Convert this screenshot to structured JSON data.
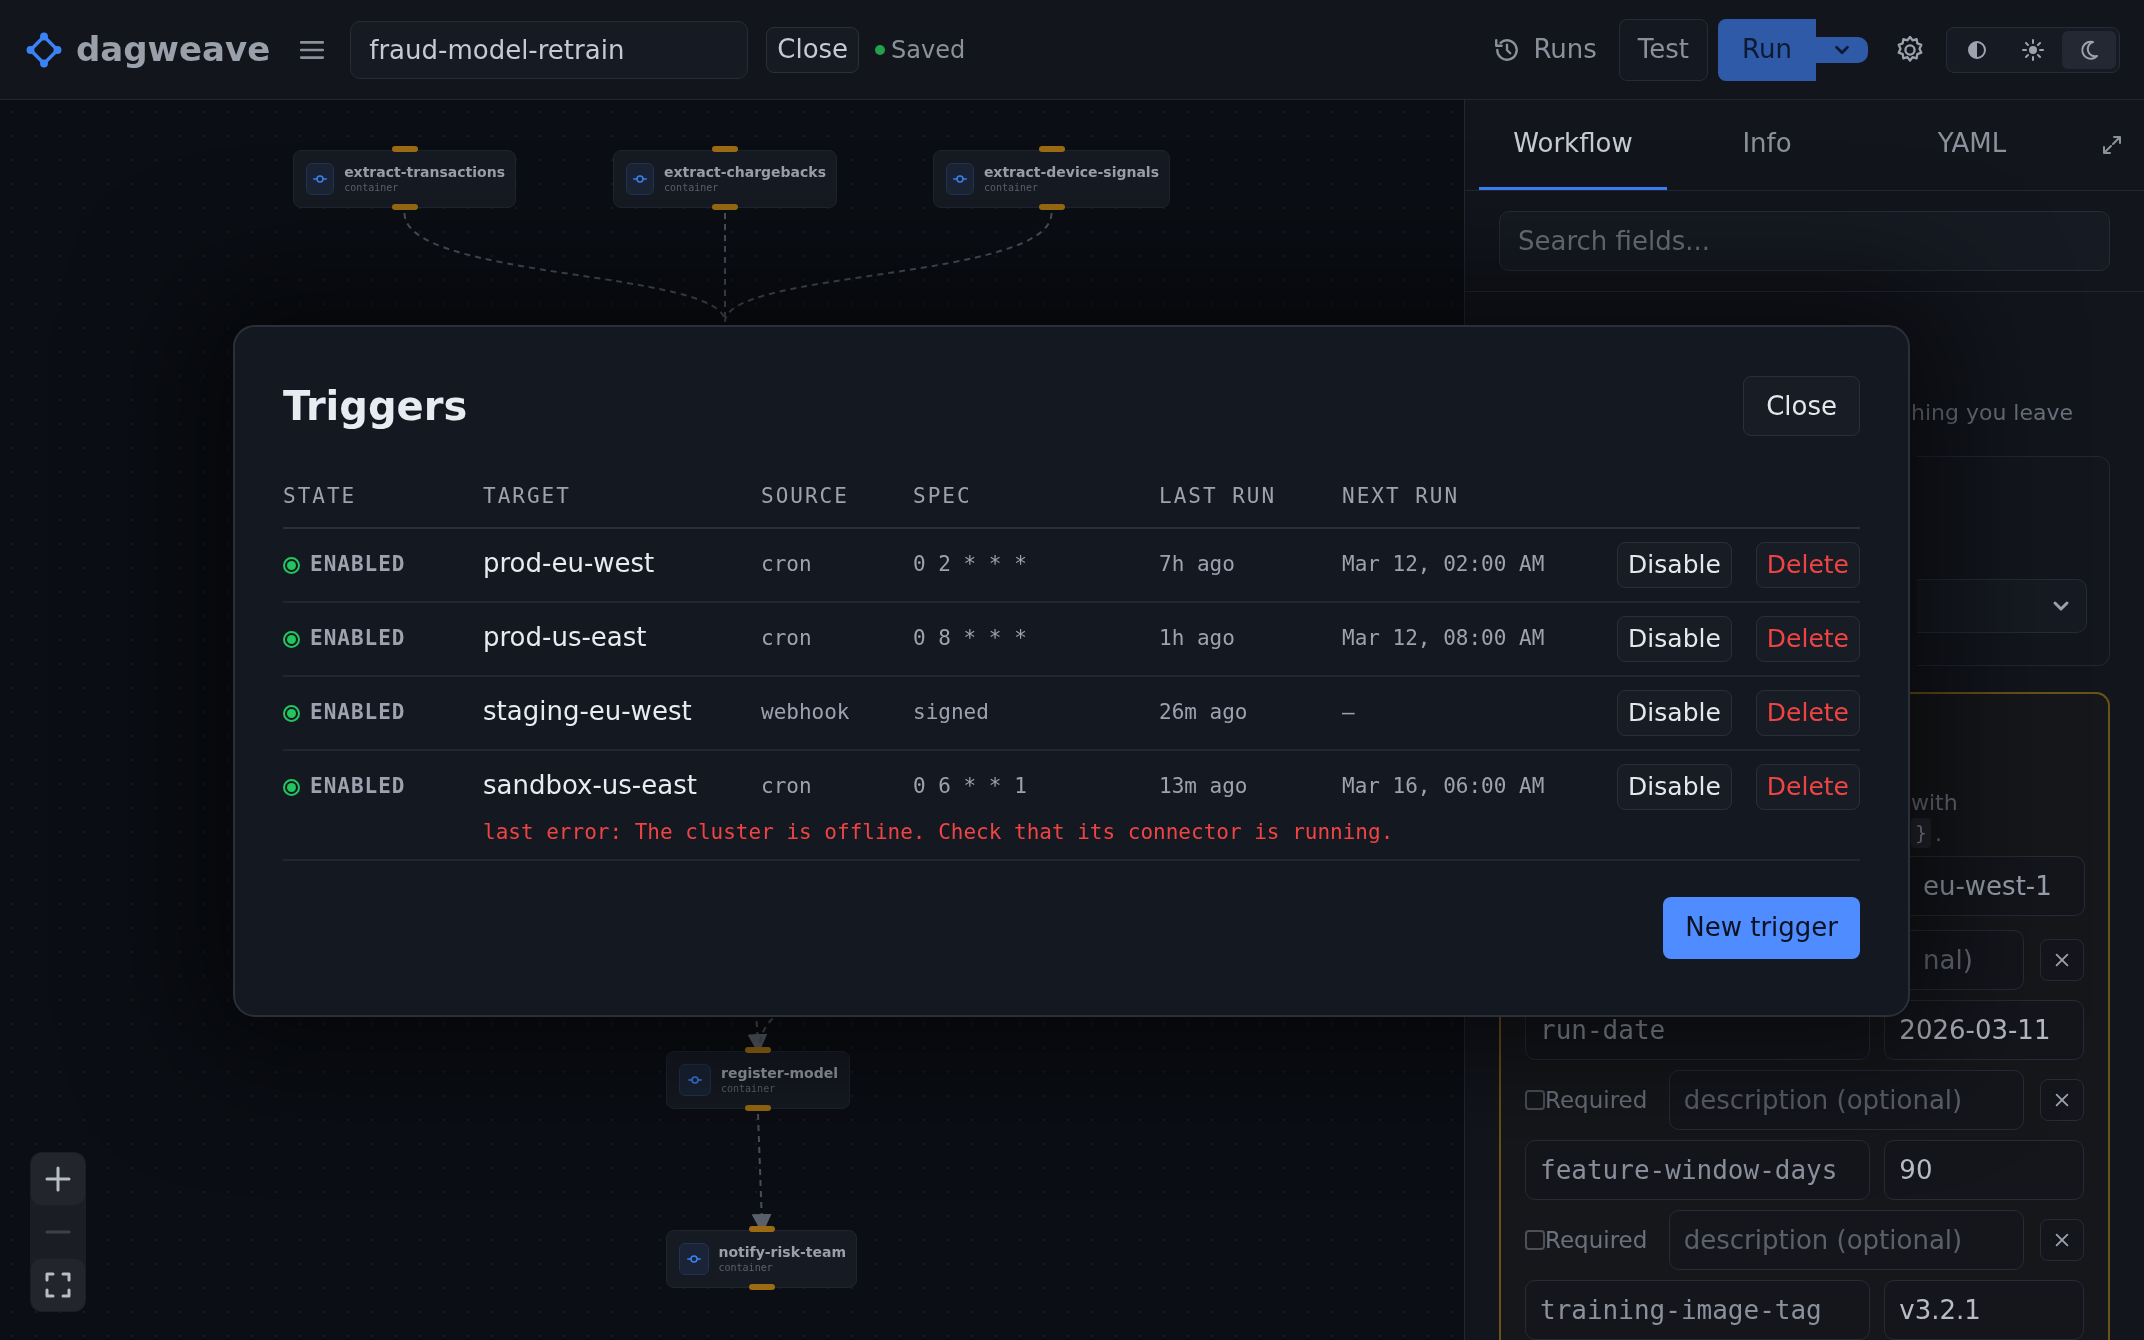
{
  "app": {
    "name": "dagweave"
  },
  "toolbar": {
    "workflow_name": "fraud-model-retrain",
    "close": "Close",
    "save_status": "Saved",
    "runs": "Runs",
    "test": "Test",
    "run": "Run",
    "theme_modes": [
      {
        "kind": "system",
        "selected": false
      },
      {
        "kind": "light",
        "selected": false
      },
      {
        "kind": "dark",
        "selected": true
      }
    ]
  },
  "canvas": {
    "top_nodes": [
      {
        "title": "extract-transactions",
        "subtitle": "container"
      },
      {
        "title": "extract-chargebacks",
        "subtitle": "container"
      },
      {
        "title": "extract-device-signals",
        "subtitle": "container"
      }
    ],
    "bottom_nodes": [
      {
        "title": "register-model",
        "subtitle": "container"
      },
      {
        "title": "notify-risk-team",
        "subtitle": "container"
      }
    ],
    "zoom_controls": [
      {
        "kind": "zoom-in",
        "disabled": false
      },
      {
        "kind": "zoom-out",
        "disabled": true
      },
      {
        "kind": "fit",
        "disabled": false
      }
    ]
  },
  "panel": {
    "tabs": [
      {
        "label": "Workflow",
        "selected": true
      },
      {
        "label": "Info",
        "selected": false
      },
      {
        "label": "YAML",
        "selected": false
      }
    ],
    "search": {
      "placeholder": "Search fields..."
    },
    "hint_fragment": "hing you leave",
    "note_fragment": "with",
    "code_fragment": "}",
    "note_tail": ".",
    "value_fragment": "eu-west-1",
    "description_fragment": "nal)",
    "params": [
      {
        "name": "run-date",
        "value": "2026-03-11",
        "required": false,
        "required_label": "Required",
        "description_placeholder": "description (optional)"
      },
      {
        "name": "feature-window-days",
        "value": "90",
        "required": false,
        "required_label": "Required",
        "description_placeholder": "description (optional)"
      },
      {
        "name": "training-image-tag",
        "value": "v3.2.1"
      }
    ]
  },
  "modal": {
    "title": "Triggers",
    "close": "Close",
    "columns": [
      "STATE",
      "TARGET",
      "SOURCE",
      "SPEC",
      "LAST RUN",
      "NEXT RUN"
    ],
    "rows": [
      {
        "enabled": true,
        "state": "ENABLED",
        "target": "prod-eu-west",
        "source": "cron",
        "spec": "0 2 * * *",
        "last_run": "7h ago",
        "next_run": "Mar 12, 02:00 AM",
        "toggle": "Disable",
        "delete": "Delete"
      },
      {
        "enabled": true,
        "state": "ENABLED",
        "target": "prod-us-east",
        "source": "cron",
        "spec": "0 8 * * *",
        "last_run": "1h ago",
        "next_run": "Mar 12, 08:00 AM",
        "toggle": "Disable",
        "delete": "Delete"
      },
      {
        "enabled": true,
        "state": "ENABLED",
        "target": "staging-eu-west",
        "source": "webhook",
        "spec": "signed",
        "last_run": "26m ago",
        "next_run": "—",
        "toggle": "Disable",
        "delete": "Delete"
      },
      {
        "enabled": true,
        "state": "ENABLED",
        "target": "sandbox-us-east",
        "source": "cron",
        "spec": "0 6 * * 1",
        "last_run": "13m ago",
        "next_run": "Mar 16, 06:00 AM",
        "toggle": "Disable",
        "delete": "Delete",
        "error": "last error: The cluster is offline. Check that its connector is running."
      }
    ],
    "new_button": "New trigger"
  }
}
